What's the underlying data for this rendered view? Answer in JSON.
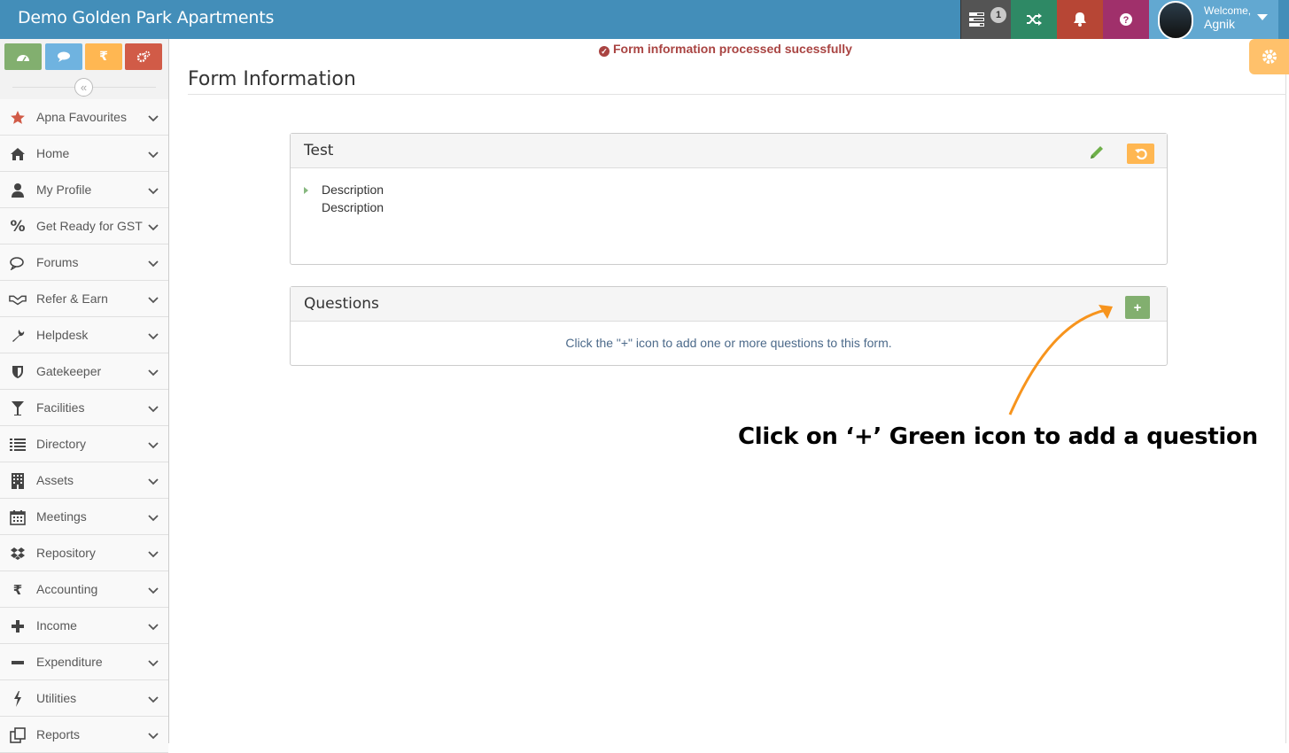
{
  "header": {
    "title": "Demo Golden Park Apartments",
    "tasks_badge": "1",
    "welcome": "Welcome,",
    "user_name": "Agnik"
  },
  "sidebar": {
    "shortcuts": [
      "dashboard-icon",
      "comments-icon",
      "rupee-icon",
      "cogs-icon"
    ],
    "items": [
      {
        "label": "Apna Favourites",
        "icon": "star-icon"
      },
      {
        "label": "Home",
        "icon": "home-icon"
      },
      {
        "label": "My Profile",
        "icon": "user-icon"
      },
      {
        "label": "Get Ready for GST",
        "icon": "percent-icon"
      },
      {
        "label": "Forums",
        "icon": "comments-icon"
      },
      {
        "label": "Refer & Earn",
        "icon": "handshake-icon"
      },
      {
        "label": "Helpdesk",
        "icon": "wrench-icon"
      },
      {
        "label": "Gatekeeper",
        "icon": "shield-icon"
      },
      {
        "label": "Facilities",
        "icon": "glass-icon"
      },
      {
        "label": "Directory",
        "icon": "list-icon"
      },
      {
        "label": "Assets",
        "icon": "building-icon"
      },
      {
        "label": "Meetings",
        "icon": "calendar-icon"
      },
      {
        "label": "Repository",
        "icon": "dropbox-icon"
      },
      {
        "label": "Accounting",
        "icon": "rupee-icon"
      },
      {
        "label": "Income",
        "icon": "plus-icon"
      },
      {
        "label": "Expenditure",
        "icon": "minus-icon"
      },
      {
        "label": "Utilities",
        "icon": "bolt-icon"
      },
      {
        "label": "Reports",
        "icon": "reports-icon"
      }
    ]
  },
  "alert": {
    "success_message": "Form information processed sucessfully"
  },
  "main": {
    "page_title": "Form Information",
    "form": {
      "name": "Test",
      "description_label": "Description",
      "description_value": "Description"
    },
    "questions": {
      "title": "Questions",
      "add_label": "+",
      "empty_message": "Click the \"+\" icon to add one or more questions to this form."
    }
  },
  "annotation": {
    "text": "Click on ‘+’ Green icon to add a question",
    "color": "#f7941d"
  },
  "colors": {
    "topbar": "#438eb9",
    "success_text": "#a94442",
    "add_button": "#82af6f",
    "undo_button": "#ffb752"
  }
}
